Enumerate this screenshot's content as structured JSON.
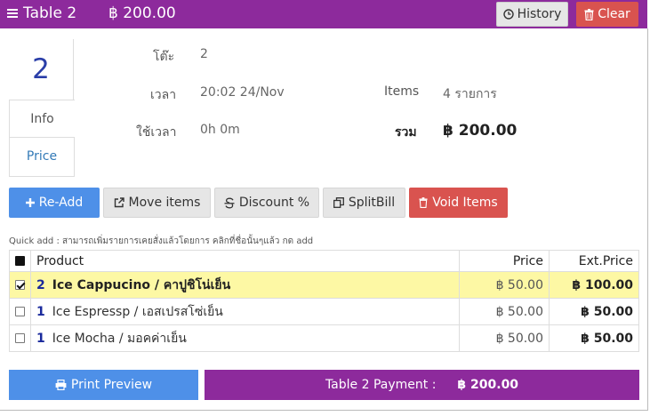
{
  "header": {
    "title": "Table 2",
    "total": "฿ 200.00",
    "history_label": "History",
    "clear_label": "Clear"
  },
  "table_number": "2",
  "tabs": [
    {
      "label": "Info"
    },
    {
      "label": "Price"
    }
  ],
  "info": {
    "table_label": "โต๊ะ",
    "table_value": "2",
    "time_label": "เวลา",
    "time_value": "20:02 24/Nov",
    "duration_label": "ใช้เวลา",
    "duration_value": "0h 0m",
    "items_label": "Items",
    "items_value": "4 รายการ",
    "sum_label": "รวม",
    "sum_value": "฿ 200.00"
  },
  "actions": {
    "readd": "Re-Add",
    "move": "Move items",
    "discount": "Discount %",
    "split": "SplitBill",
    "void": "Void Items"
  },
  "quick_add_text": "Quick add : สามารถเพิ่มรายการเคยสั่งแล้วโดยการ คลิกที่ชื่อนั้นๆแล้ว กด add",
  "columns": {
    "product": "Product",
    "price": "Price",
    "ext_price": "Ext.Price"
  },
  "rows": [
    {
      "checked": true,
      "qty": "2",
      "name": "Ice Cappucino / คาปูชิโน่เย็น",
      "price": "฿ 50.00",
      "ext": "฿ 100.00"
    },
    {
      "checked": false,
      "qty": "1",
      "name": "Ice Espressp / เอสเปรสโซ่เย็น",
      "price": "฿ 50.00",
      "ext": "฿ 50.00"
    },
    {
      "checked": false,
      "qty": "1",
      "name": "Ice Mocha / มอคค่าเย็น",
      "price": "฿ 50.00",
      "ext": "฿ 50.00"
    }
  ],
  "footer": {
    "print_label": "Print Preview",
    "payment_label": "Table 2 Payment :",
    "payment_amount": "฿ 200.00"
  },
  "colors": {
    "brand_purple": "#8d2a9c",
    "primary_blue": "#4e90e8",
    "danger_red": "#d9534f",
    "selected_row": "#fdf8a4"
  }
}
